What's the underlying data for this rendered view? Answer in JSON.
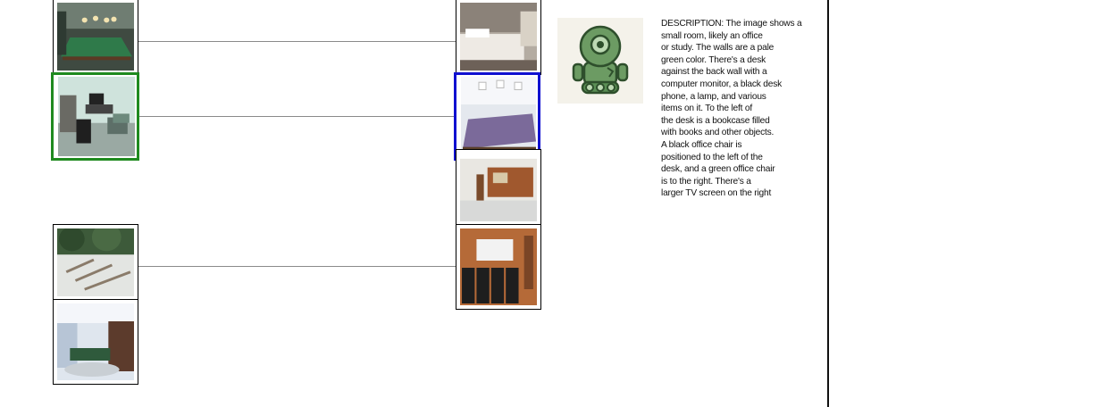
{
  "left_column": {
    "items": [
      {
        "name": "billiard-room-photo",
        "alt": "billiard room"
      },
      {
        "name": "office-study-photo",
        "alt": "office study",
        "selected": true,
        "selection_color": "#1f8a1f"
      },
      {
        "name": "patio-loungers-photo",
        "alt": "patio loungers"
      },
      {
        "name": "living-room-photo",
        "alt": "living room"
      }
    ]
  },
  "right_column": {
    "items": [
      {
        "name": "bedroom-photo",
        "alt": "bedroom"
      },
      {
        "name": "pool-table-photo",
        "alt": "pool table room",
        "selected": true,
        "selection_color": "#1010d0"
      },
      {
        "name": "basement-bar-photo",
        "alt": "basement bar"
      },
      {
        "name": "home-theater-photo",
        "alt": "home theater"
      }
    ]
  },
  "agent": {
    "icon": "robot-icon",
    "description": "DESCRIPTION: The image shows a\nsmall room, likely an office\nor study. The walls are a pale\ngreen color. There's a desk\nagainst the back wall with a\ncomputer monitor, a black desk\nphone, a lamp, and various\nitems on it. To the left of\nthe desk is a bookcase filled\nwith books and other objects.\nA black office chair is\npositioned to the left of the\ndesk, and a green office chair\nis to the right. There's a\nlarger TV screen on the right"
  },
  "colors": {
    "left_selection": "#1f8a1f",
    "right_selection": "#1010d0",
    "robot": "#5a8f55"
  }
}
